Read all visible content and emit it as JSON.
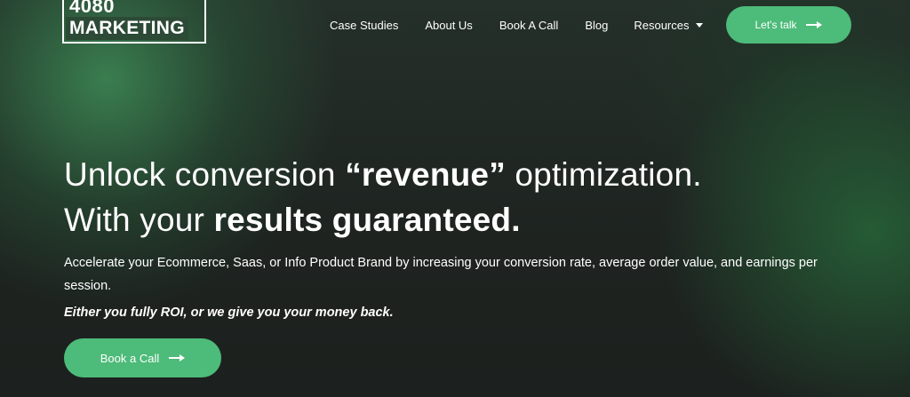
{
  "header": {
    "logo": {
      "line1": "4080",
      "line2": "MARKETING"
    },
    "nav": [
      {
        "label": "Case Studies"
      },
      {
        "label": "About Us"
      },
      {
        "label": "Book A Call"
      },
      {
        "label": "Blog"
      },
      {
        "label": "Resources"
      }
    ],
    "cta_label": "Let's talk"
  },
  "hero": {
    "line1": {
      "pre": "Unlock conversion ",
      "bold": "“revenue”",
      "post": " optimization."
    },
    "line2": {
      "pre": "With your ",
      "bold": "results guaranteed."
    },
    "subtext": "Accelerate your Ecommerce, Saas, or Info Product Brand by increasing your conversion rate, average order value, and earnings per session.",
    "guarantee": "Either you fully ROI, or we give you your money back.",
    "cta_label": "Book a Call"
  },
  "colors": {
    "accent": "#4dbb79",
    "background": "#1f2320",
    "glow": "#3e8c56"
  },
  "icons": [
    "arrow-right-icon",
    "chevron-down-icon"
  ]
}
